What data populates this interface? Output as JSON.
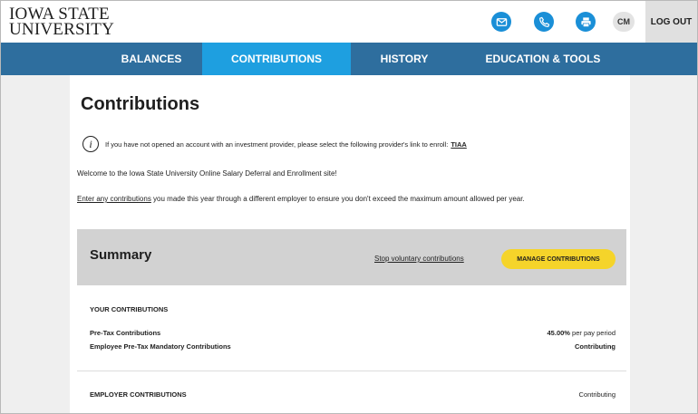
{
  "header": {
    "logo_line1": "IOWA STATE",
    "logo_line2": "UNIVERSITY",
    "avatar_initials": "CM",
    "logout_label": "LOG OUT",
    "accent_color": "#1a8fd7",
    "icons": [
      "mail-icon",
      "phone-icon",
      "printer-icon"
    ]
  },
  "nav": {
    "items": [
      {
        "label": "BALANCES"
      },
      {
        "label": "CONTRIBUTIONS"
      },
      {
        "label": "HISTORY"
      },
      {
        "label": "EDUCATION & TOOLS"
      }
    ],
    "active": "CONTRIBUTIONS",
    "bg_color": "#2e6e9e",
    "active_color": "#1e9fe0"
  },
  "page": {
    "title": "Contributions",
    "info_text": "If you have not opened an account with an investment provider, please select the following provider's link to enroll:",
    "info_link": "TIAA",
    "welcome": "Welcome to the Iowa State University Online Salary Deferral and Enrollment site!",
    "enter_link": "Enter any contributions",
    "enter_text": " you made this year through a different employer to ensure you don't exceed the maximum amount allowed per year."
  },
  "summary": {
    "title": "Summary",
    "stop_link": "Stop voluntary contributions",
    "manage_button": "MANAGE CONTRIBUTIONS",
    "your_heading": "YOUR CONTRIBUTIONS",
    "rows": [
      {
        "label": "Pre-Tax Contributions",
        "value_bold": "45.00%",
        "value_suffix": " per pay period"
      },
      {
        "label": "Employee Pre-Tax Mandatory Contributions",
        "value_bold": "Contributing",
        "value_suffix": ""
      }
    ],
    "employer_heading": "EMPLOYER CONTRIBUTIONS",
    "employer_value": "Contributing",
    "button_color": "#f5d42a"
  }
}
